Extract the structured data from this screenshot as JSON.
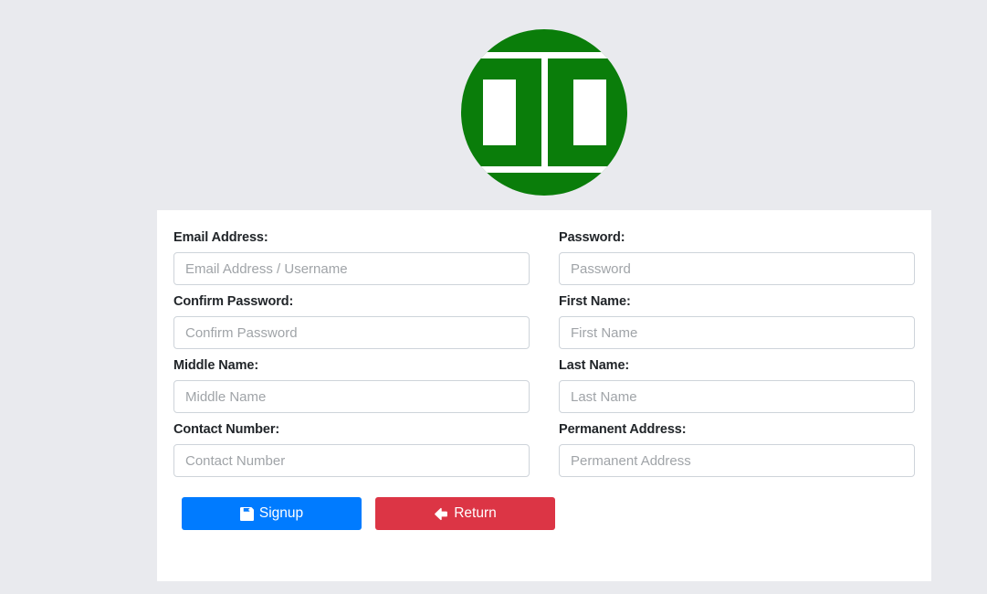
{
  "page": {
    "background_color": "#e9eaee"
  },
  "logo": {
    "name": "brand-logo",
    "shape": "circle",
    "color": "#0a7d0a",
    "mark": "nested-brackets"
  },
  "form": {
    "card_background": "#ffffff",
    "rows": [
      {
        "left": {
          "label": "Email Address:",
          "placeholder": "Email Address / Username",
          "value": "",
          "name": "email-field",
          "type": "text"
        },
        "right": {
          "label": "Password:",
          "placeholder": "Password",
          "value": "",
          "name": "password-field",
          "type": "password"
        }
      },
      {
        "left": {
          "label": "Confirm Password:",
          "placeholder": "Confirm Password",
          "value": "",
          "name": "confirm-password-field",
          "type": "password"
        },
        "right": {
          "label": "First Name:",
          "placeholder": "First Name",
          "value": "",
          "name": "first-name-field",
          "type": "text"
        }
      },
      {
        "left": {
          "label": "Middle Name:",
          "placeholder": "Middle Name",
          "value": "",
          "name": "middle-name-field",
          "type": "text"
        },
        "right": {
          "label": "Last Name:",
          "placeholder": "Last Name",
          "value": "",
          "name": "last-name-field",
          "type": "text"
        }
      },
      {
        "left": {
          "label": "Contact Number:",
          "placeholder": "Contact Number",
          "value": "",
          "name": "contact-number-field",
          "type": "text"
        },
        "right": {
          "label": "Permanent Address:",
          "placeholder": "Permanent Address",
          "value": "",
          "name": "permanent-address-field",
          "type": "text"
        }
      }
    ],
    "buttons": [
      {
        "label": "Signup",
        "icon": "save-icon",
        "color": "#007bff",
        "name": "signup-button"
      },
      {
        "label": "Return",
        "icon": "arrow-left-icon",
        "color": "#dc3545",
        "name": "return-button"
      }
    ]
  }
}
